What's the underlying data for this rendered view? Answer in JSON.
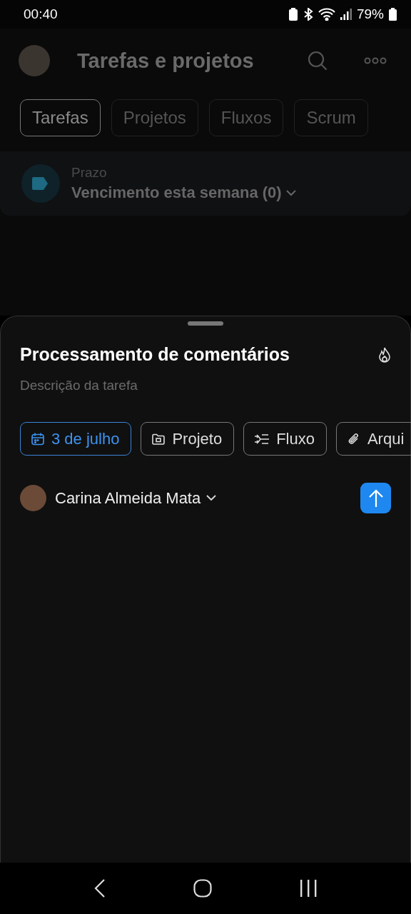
{
  "status_bar": {
    "time": "00:40",
    "battery": "79%"
  },
  "header": {
    "title": "Tarefas e projetos"
  },
  "tabs": [
    {
      "label": "Tarefas",
      "selected": true
    },
    {
      "label": "Projetos",
      "selected": false
    },
    {
      "label": "Fluxos",
      "selected": false
    },
    {
      "label": "Scrum",
      "selected": false
    }
  ],
  "filter": {
    "label": "Prazo",
    "value": "Vencimento esta semana (0)"
  },
  "sheet": {
    "title": "Processamento de comentários",
    "description": {
      "placeholder": "Descrição da tarefa"
    },
    "chips": [
      {
        "kind": "date",
        "label": "3 de julho",
        "active": true
      },
      {
        "kind": "project",
        "label": "Projeto",
        "active": false
      },
      {
        "kind": "flow",
        "label": "Fluxo",
        "active": false
      },
      {
        "kind": "attachment",
        "label": "Arqui",
        "active": false
      }
    ],
    "assignee": "Carina Almeida Mata"
  }
}
